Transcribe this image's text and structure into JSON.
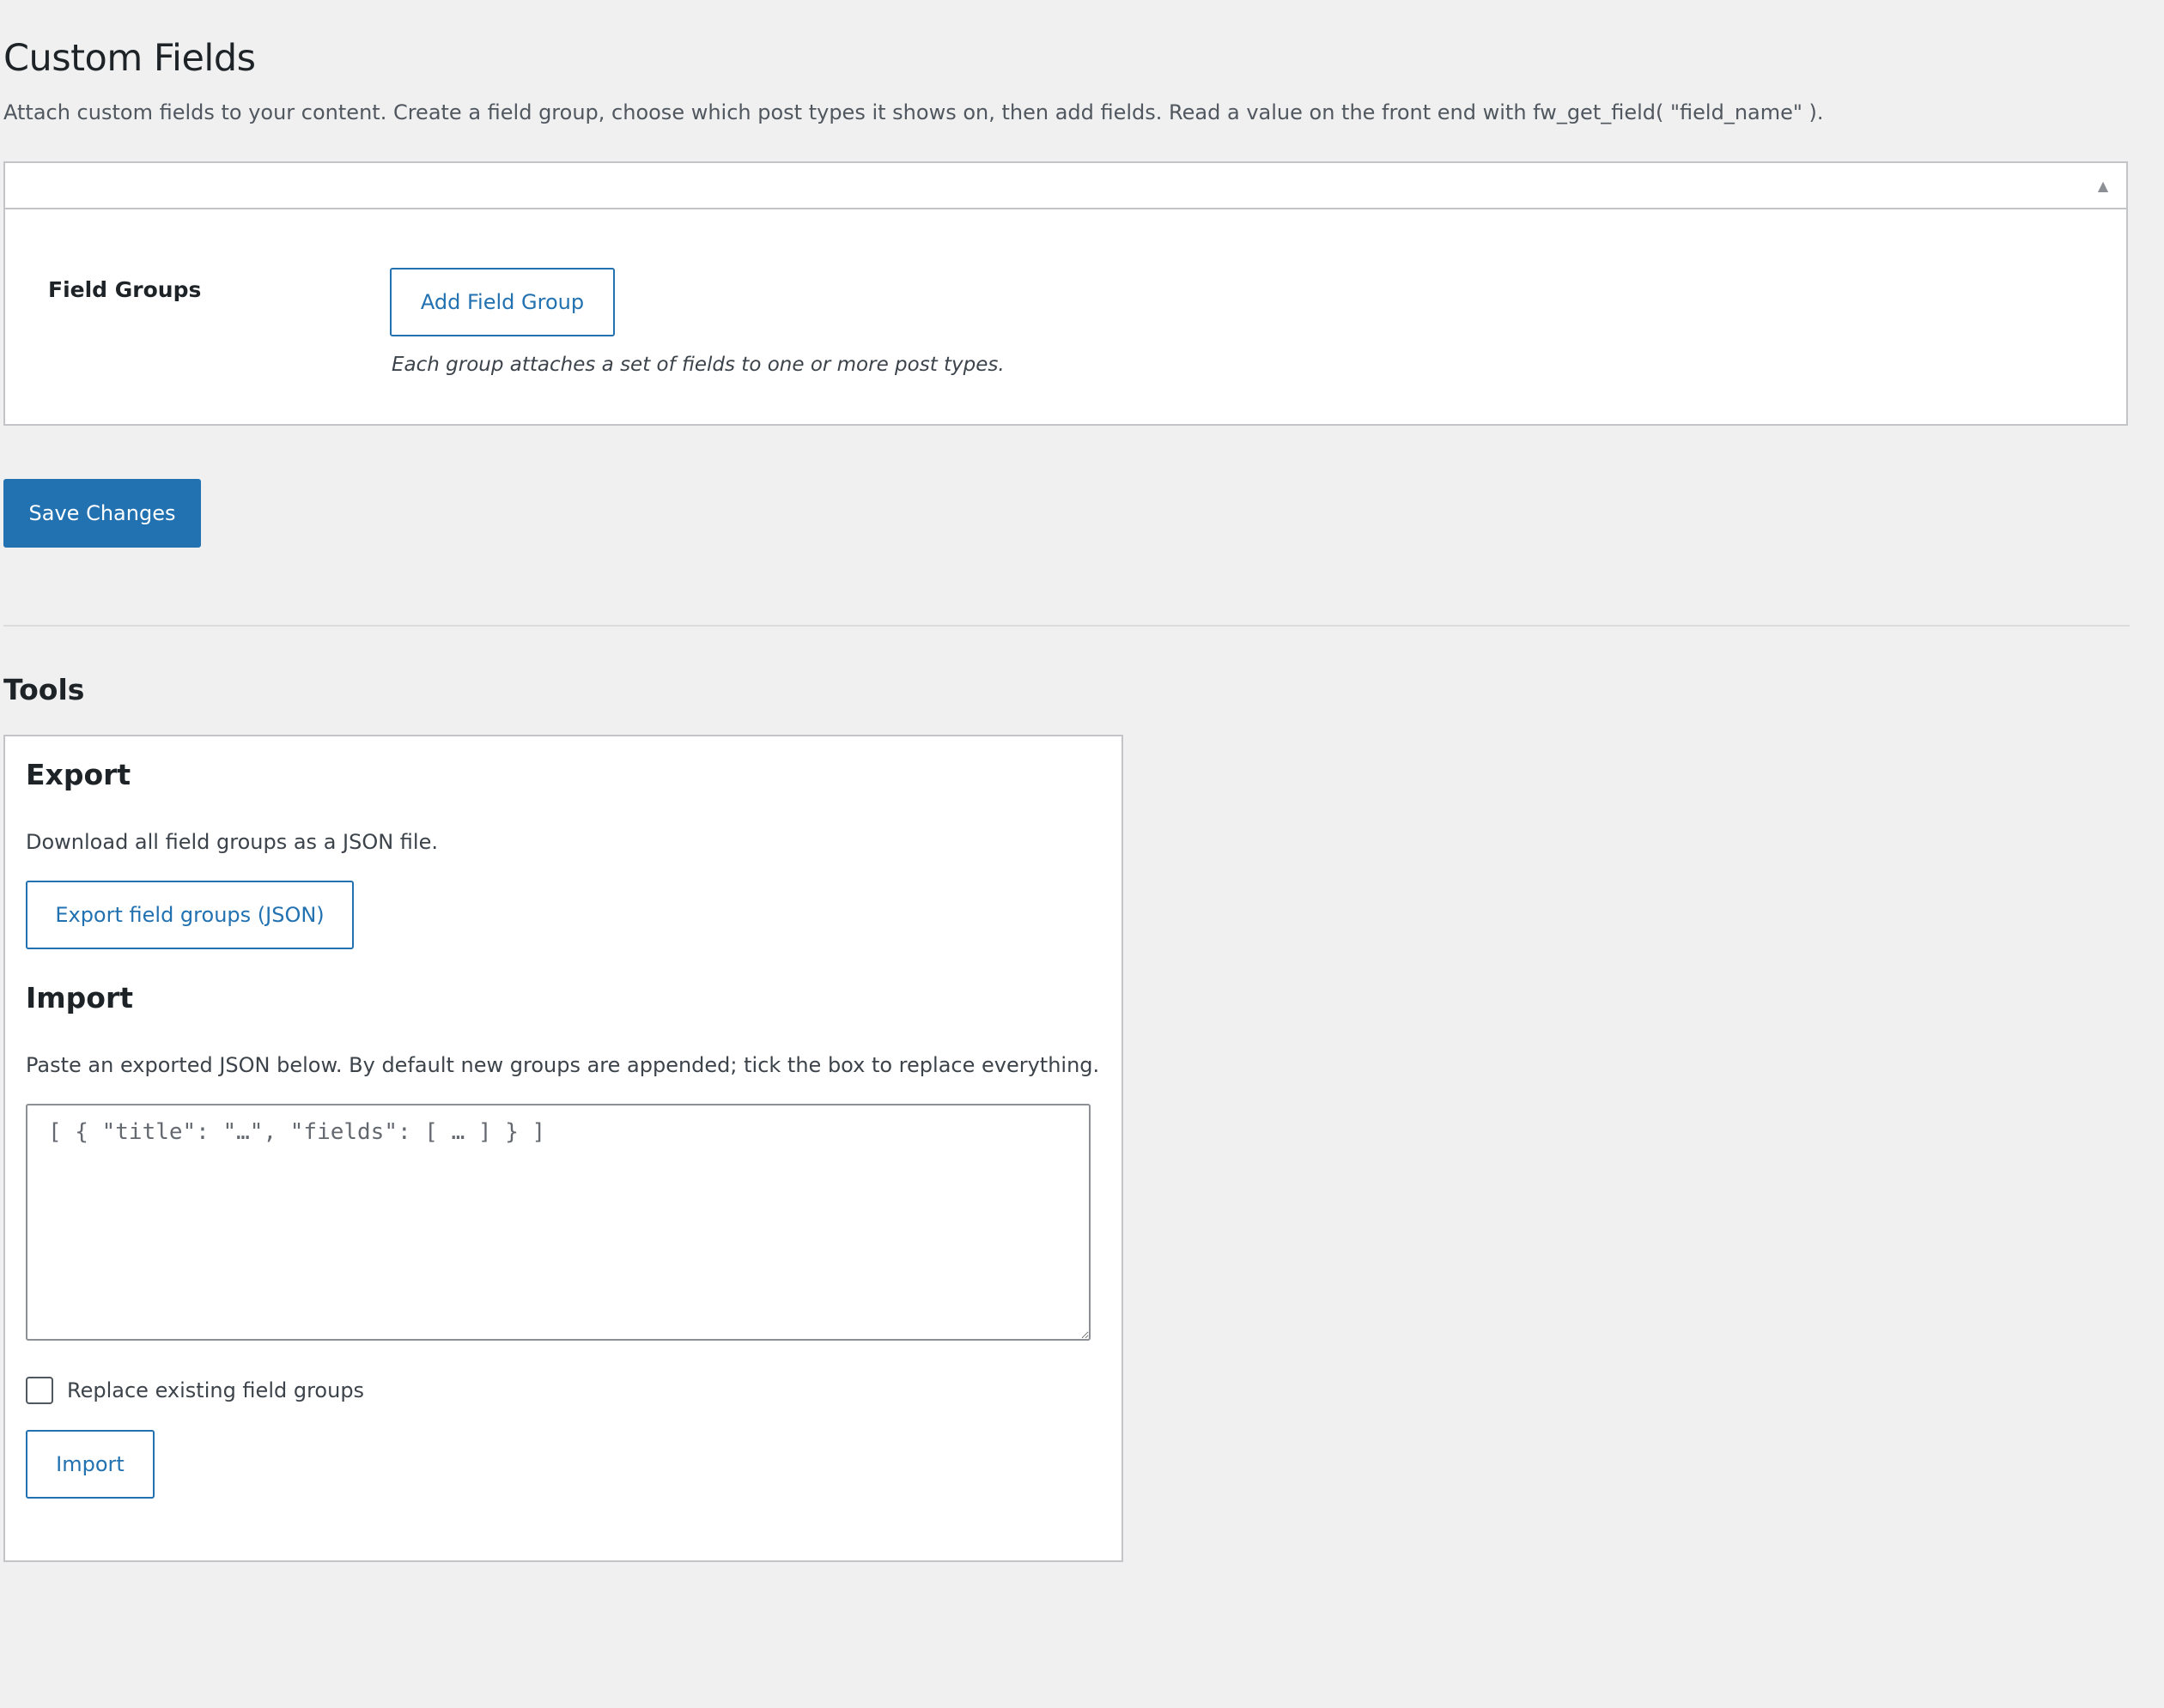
{
  "page": {
    "title": "Custom Fields",
    "description": "Attach custom fields to your content. Create a field group, choose which post types it shows on, then add fields. Read a value on the front end with fw_get_field( \"field_name\" )."
  },
  "field_groups": {
    "toggle_icon": "triangle-up-icon",
    "label": "Field Groups",
    "add_button": "Add Field Group",
    "help": "Each group attaches a set of fields to one or more post types."
  },
  "actions": {
    "save_label": "Save Changes"
  },
  "tools": {
    "heading": "Tools",
    "export": {
      "heading": "Export",
      "description": "Download all field groups as a JSON file.",
      "button": "Export field groups (JSON)"
    },
    "import": {
      "heading": "Import",
      "description": "Paste an exported JSON below. By default new groups are appended; tick the box to replace everything.",
      "placeholder": "[ { \"title\": \"…\", \"fields\": [ … ] } ]",
      "value": "",
      "replace_label": "Replace existing field groups",
      "replace_checked": false,
      "button": "Import"
    }
  },
  "colors": {
    "accent": "#2271b1",
    "background": "#f0f0f1",
    "panel": "#ffffff",
    "border": "#c3c4c7",
    "heading": "#1d2327",
    "text": "#3c434a"
  }
}
